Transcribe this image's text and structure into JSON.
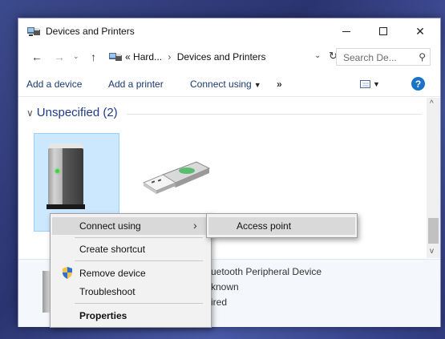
{
  "window": {
    "title": "Devices and Printers",
    "minimize_glyph": "",
    "close_glyph": "✕"
  },
  "address": {
    "back_glyph": "←",
    "forward_glyph": "→",
    "recent_glyph": "⌄",
    "up_glyph": "↑",
    "prefix": "«",
    "crumb_1": "Hard...",
    "crumb_separator": "›",
    "crumb_2": "Devices and Printers",
    "dropdown_glyph": "⌄",
    "refresh_glyph": "↻",
    "search_placeholder": "Search De...",
    "search_glyph": "⚲"
  },
  "commands": {
    "add_device": "Add a device",
    "add_printer": "Add a printer",
    "connect_using": "Connect using",
    "more": "»",
    "help": "?"
  },
  "group": {
    "chevron": "∨",
    "label": "Unspecified (2)"
  },
  "details": {
    "line_1": "uetooth Peripheral Device",
    "line_2": "known",
    "line_3": "ired"
  },
  "context_menu": {
    "items": [
      {
        "label": "Connect using",
        "has_submenu": true
      },
      {
        "label": "Create shortcut"
      },
      {
        "label": "Remove device",
        "icon": "uac-shield-icon"
      },
      {
        "label": "Troubleshoot"
      },
      {
        "label": "Properties",
        "bold": true
      }
    ],
    "submenu_arrow": "›"
  },
  "submenu": {
    "items": [
      {
        "label": "Access point"
      }
    ]
  },
  "scroll": {
    "up_glyph": "^",
    "down_glyph": "v"
  },
  "colors": {
    "accent": "#1a73c9",
    "selection": "#cce8ff",
    "link": "#1a3a70",
    "group_header": "#1e3a8a"
  }
}
